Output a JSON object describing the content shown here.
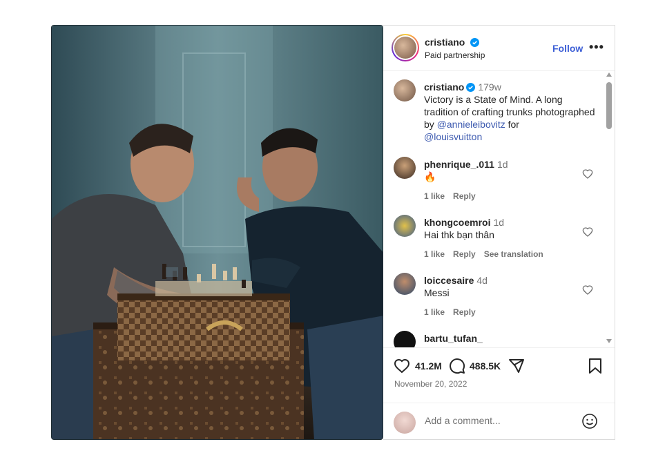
{
  "post": {
    "author": "cristiano",
    "subtitle": "Paid partnership",
    "follow_label": "Follow",
    "more_label": "•••"
  },
  "caption": {
    "username": "cristiano",
    "time": "179w",
    "text_before": "Victory is a State of Mind. A long tradition of crafting trunks photographed by ",
    "mention1": "@annieleibovitz",
    "text_mid": " for",
    "mention2": "@louisvuitton"
  },
  "comments": [
    {
      "username": "phenrique_.011",
      "time": "1d",
      "text": "🔥",
      "likes": "1 like",
      "reply": "Reply",
      "translate": ""
    },
    {
      "username": "khongcoemroi",
      "time": "1d",
      "text": "Hai thk bạn thân",
      "likes": "1 like",
      "reply": "Reply",
      "translate": "See translation"
    },
    {
      "username": "loiccesaire",
      "time": "4d",
      "text": "Messi",
      "likes": "1 like",
      "reply": "Reply",
      "translate": ""
    },
    {
      "username": "bartu_tufan_",
      "time": "",
      "text": "",
      "likes": "",
      "reply": "",
      "translate": ""
    }
  ],
  "stats": {
    "likes": "41.2M",
    "comments": "488.5K",
    "date": "November 20, 2022"
  },
  "composer": {
    "placeholder": "Add a comment..."
  },
  "colors": {
    "accent": "#0095f6",
    "verified": "#0095f6",
    "text": "#262626",
    "muted": "#737373"
  },
  "icons": {
    "like": "heart-icon",
    "comment": "comment-bubble-icon",
    "share": "paper-plane-icon",
    "save": "bookmark-icon",
    "emoji": "smiley-icon"
  }
}
